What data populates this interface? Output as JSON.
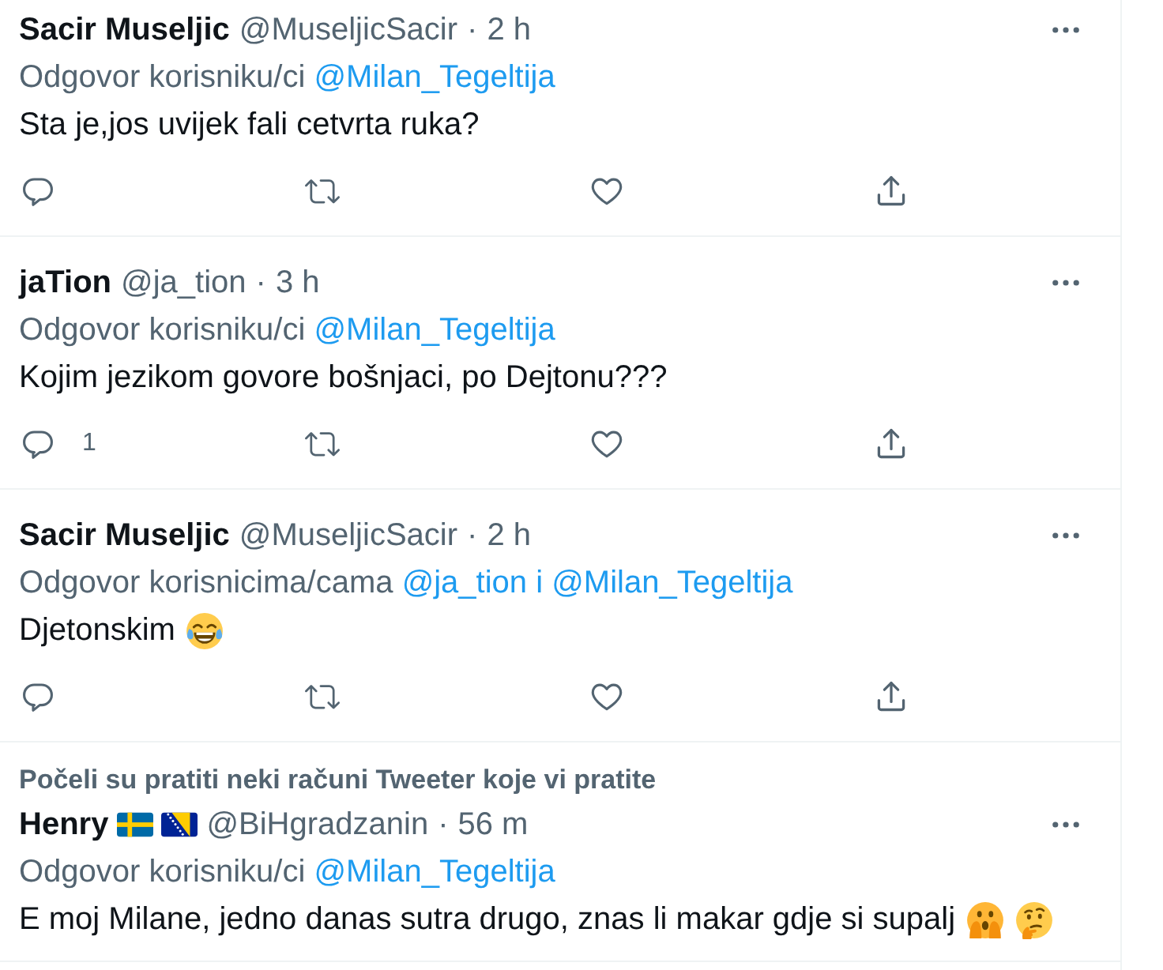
{
  "tweets": [
    {
      "name": "Sacir Museljic",
      "handle": "@MuseljicSacir",
      "separator": "·",
      "time": "2 h",
      "reply_to": {
        "label": "Odgovor korisniku/ci",
        "mentions": [
          "@Milan_Tegeltija"
        ]
      },
      "text": "Sta je,jos uvijek fali cetvrta ruka?",
      "actions": [
        {
          "kind": "reply"
        },
        {
          "kind": "retweet"
        },
        {
          "kind": "like"
        },
        {
          "kind": "share"
        }
      ]
    },
    {
      "name": "jaTion",
      "handle": "@ja_tion",
      "separator": "·",
      "time": "3 h",
      "reply_to": {
        "label": "Odgovor korisniku/ci",
        "mentions": [
          "@Milan_Tegeltija"
        ]
      },
      "text": "Kojim jezikom govore bošnjaci, po Dejtonu???",
      "actions": [
        {
          "kind": "reply",
          "count": "1"
        },
        {
          "kind": "retweet"
        },
        {
          "kind": "like"
        },
        {
          "kind": "share"
        }
      ]
    },
    {
      "name": "Sacir Museljic",
      "handle": "@MuseljicSacir",
      "separator": "·",
      "time": "2 h",
      "reply_to": {
        "label": "Odgovor korisnicima/cama",
        "mentions": [
          "@ja_tion",
          "@Milan_Tegeltija"
        ],
        "joiner": "i"
      },
      "text": "Djetonskim",
      "emojis": [
        {
          "kind": "laughing"
        }
      ],
      "actions": [
        {
          "kind": "reply"
        },
        {
          "kind": "retweet"
        },
        {
          "kind": "like"
        },
        {
          "kind": "share"
        }
      ]
    },
    {
      "context": "Počeli su pratiti neki računi Tweeter koje vi pratite",
      "name": "Henry",
      "flags": [
        {
          "kind": "sweden"
        },
        {
          "kind": "bosnia"
        }
      ],
      "handle": "@BiHgradzanin",
      "separator": "·",
      "time": "56 m",
      "reply_to": {
        "label": "Odgovor korisniku/ci",
        "mentions": [
          "@Milan_Tegeltija"
        ]
      },
      "text": "E moj Milane, jedno danas sutra drugo, znas li makar gdje si supalj",
      "emojis": [
        {
          "kind": "shocked"
        },
        {
          "kind": "thinking"
        }
      ]
    }
  ]
}
